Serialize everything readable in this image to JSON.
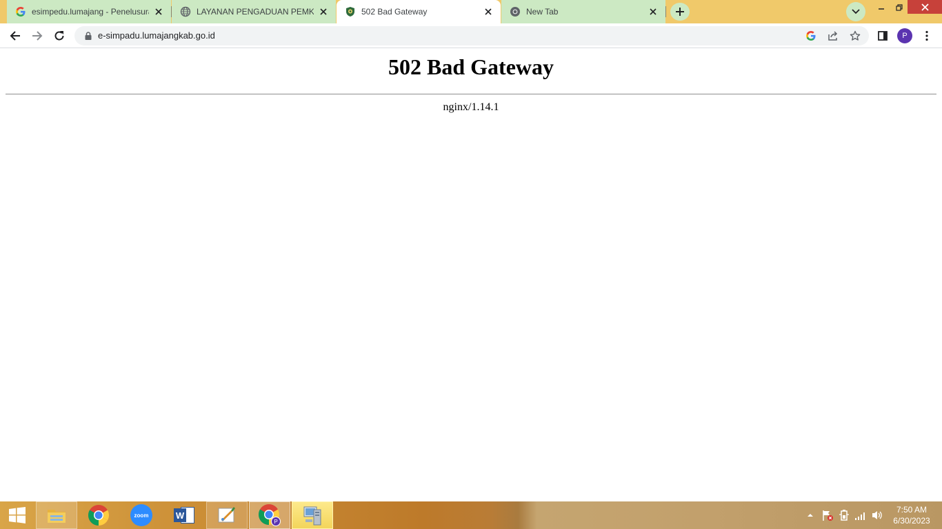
{
  "browser": {
    "tabs": [
      {
        "title": "esimpedu.lumajang - Penelusuran",
        "favicon": "google-g-icon",
        "active": false
      },
      {
        "title": "LAYANAN PENGADUAN PEMKAB LUMAJANG",
        "favicon": "globe-icon",
        "active": false
      },
      {
        "title": "502 Bad Gateway",
        "favicon": "crest-icon",
        "active": true
      },
      {
        "title": "New Tab",
        "favicon": "chrome-icon",
        "active": false
      }
    ],
    "address_bar": {
      "url": "e-simpadu.lumajangkab.go.id"
    },
    "profile_initial": "P"
  },
  "page": {
    "heading": "502 Bad Gateway",
    "server": "nginx/1.14.1"
  },
  "taskbar": {
    "apps": [
      "file-explorer-icon",
      "chrome-icon",
      "zoom-icon",
      "word-icon",
      "paint-icon",
      "chrome-profile-icon",
      "network-computer-icon"
    ],
    "zoom_label": "zoom",
    "word_label": "W",
    "time": "7:50 AM",
    "date": "6/30/2023"
  },
  "colors": {
    "tabstrip": "#f0c96a",
    "inactive_tab": "#cce9c3",
    "avatar": "#5b34b0",
    "close_red": "#c7413a"
  }
}
